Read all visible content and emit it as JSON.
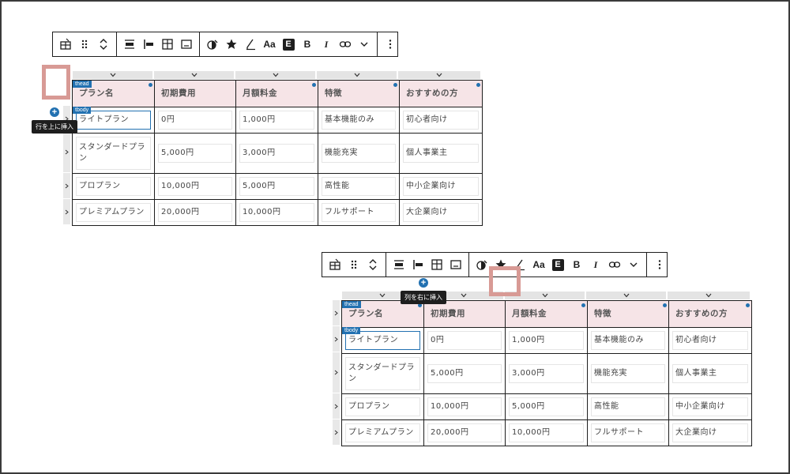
{
  "toolbar": {
    "groups": [
      [
        "table-icon",
        "drag-handle-icon",
        "move-up-down-icon"
      ],
      [
        "align-center-icon",
        "align-left-icon",
        "table-edit-icon",
        "caption-icon"
      ],
      [
        "drop-icon",
        "star-icon",
        "pen-icon",
        "Aa",
        "E",
        "B",
        "I",
        "link-icon",
        "chevron-down-icon"
      ],
      [
        "more-vertical-icon"
      ]
    ],
    "text_format_label": "Aa",
    "editor_badge_label": "E",
    "bold_label": "B",
    "italic_label": "I"
  },
  "table": {
    "thead_tag": "thead",
    "tbody_tag": "tbody",
    "headers": [
      "プラン名",
      "初期費用",
      "月額料金",
      "特徴",
      "おすすめの方"
    ],
    "rows": [
      [
        "ライトプラン",
        "0円",
        "1,000円",
        "基本機能のみ",
        "初心者向け"
      ],
      [
        "スタンダードプラン",
        "5,000円",
        "3,000円",
        "機能充実",
        "個人事業主"
      ],
      [
        "プロプラン",
        "10,000円",
        "5,000円",
        "高性能",
        "中小企業向け"
      ],
      [
        "プレミアムプラン",
        "20,000円",
        "10,000円",
        "フルサポート",
        "大企業向け"
      ]
    ]
  },
  "tooltips": {
    "insert_row_above": "行を上に挿入",
    "insert_column_right": "列を右に挿入"
  },
  "colors": {
    "accent": "#2271b1",
    "header_bg": "#f6e4e7",
    "highlight": "#d89a95"
  }
}
